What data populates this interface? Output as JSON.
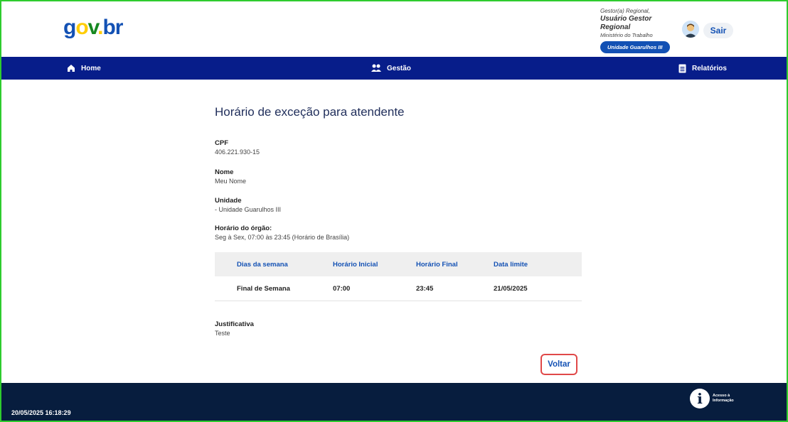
{
  "header": {
    "logo": {
      "g": "g",
      "o": "o",
      "v": "v",
      "dot": ".",
      "br": "br"
    },
    "user": {
      "role": "Gestor(a) Regional,",
      "name": "Usuário Gestor Regional",
      "org": "Ministério do Trabalho",
      "unit": "Unidade Guarulhos III"
    },
    "logout_label": "Sair"
  },
  "nav": {
    "home": "Home",
    "gestao": "Gestão",
    "relatorios": "Relatórios"
  },
  "main": {
    "title": "Horário de exceção para atendente",
    "fields": {
      "cpf_label": "CPF",
      "cpf_value": "406.221.930-15",
      "nome_label": "Nome",
      "nome_value": "Meu Nome",
      "unidade_label": "Unidade",
      "unidade_value": "- Unidade Guarulhos III",
      "horario_label": "Horário do órgão:",
      "horario_value": "Seg à Sex, 07:00 às 23:45 (Horário de Brasília)",
      "justificativa_label": "Justificativa",
      "justificativa_value": "Teste"
    },
    "table": {
      "headers": [
        "Dias da semana",
        "Horário Inicial",
        "Horário Final",
        "Data limite"
      ],
      "rows": [
        [
          "Final de Semana",
          "07:00",
          "23:45",
          "21/05/2025"
        ]
      ]
    },
    "back_label": "Voltar"
  },
  "footer": {
    "timestamp": "20/05/2025 16:18:29",
    "acesso_line1": "Acesso à",
    "acesso_line2": "Informação"
  },
  "colors": {
    "nav_bg": "#071d8a",
    "footer_bg": "#071d3e",
    "accent": "#1351b4"
  }
}
